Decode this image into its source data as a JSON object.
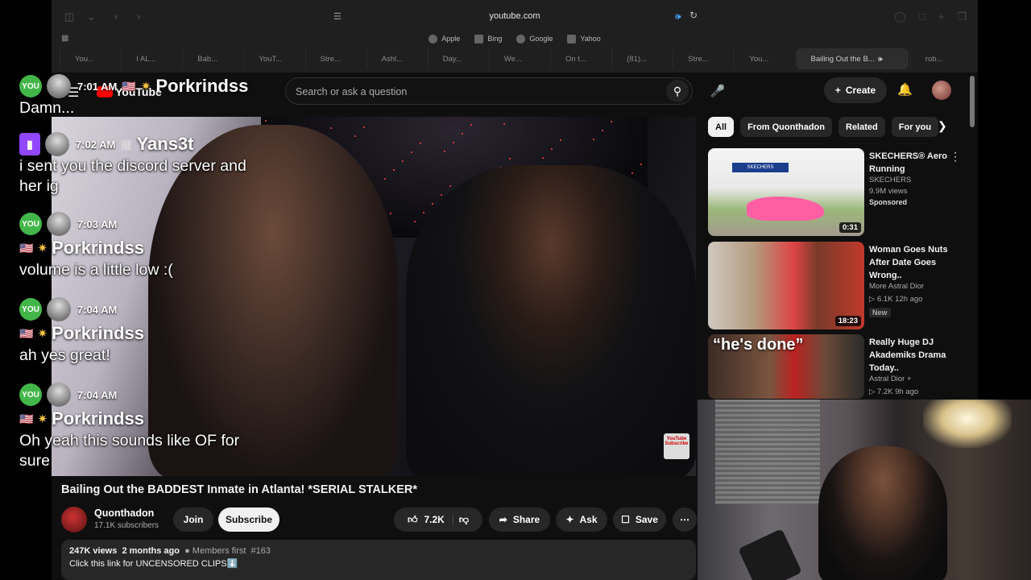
{
  "browser": {
    "url": "youtube.com",
    "favorites": [
      "Apple",
      "Bing",
      "Google",
      "Yahoo"
    ],
    "tabs": [
      "You...",
      "I AL...",
      "Bab...",
      "YouT...",
      "Stre...",
      "Ashl...",
      "Day...",
      "We...",
      "On t...",
      "(81)...",
      "Stre...",
      "You...",
      "Bailing Out the B...",
      "rob..."
    ],
    "active_tab_index": 12
  },
  "youtube": {
    "logo_text": "YouTube",
    "search_placeholder": "Search or ask a question",
    "create_label": "Create",
    "video": {
      "title": "Bailing Out the BADDEST Inmate in Atlanta! *SERIAL STALKER*",
      "channel": "Quonthadon",
      "subscribers": "17.1K subscribers",
      "join_label": "Join",
      "subscribe_label": "Subscribe",
      "likes": "7.2K",
      "share_label": "Share",
      "ask_label": "Ask",
      "save_label": "Save",
      "views": "247K views",
      "age": "2 months ago",
      "members": "Members first",
      "tag": "#163",
      "desc_line": "Click this link for UNCENSORED CLIPS⬇️"
    },
    "chips": [
      "All",
      "From Quonthadon",
      "Related",
      "For you"
    ],
    "recommendations": [
      {
        "title": "SKECHERS® Aero Running",
        "channel": "SKECHERS",
        "stats": "9.9M views",
        "badge": "Sponsored",
        "duration": "0:31"
      },
      {
        "title": "Woman Goes Nuts After Date Goes Wrong..",
        "channel": "More Astral Dior",
        "stats": "▷ 6.1K  12h ago",
        "badge": "New",
        "duration": "18:23"
      },
      {
        "title": "Really Huge DJ Akademiks Drama Today..",
        "channel": "Astral Dior +",
        "stats": "▷ 7.2K  9h ago",
        "overlay": "“he's done”"
      }
    ]
  },
  "chat": [
    {
      "platform": "YOU",
      "time": "7:01 AM",
      "name": "Porkrindss",
      "text": "Damn..."
    },
    {
      "platform": "twitch",
      "time": "7:02 AM",
      "name": "Yans3t",
      "text": "i sent you the discord server and her ig"
    },
    {
      "platform": "YOU",
      "time": "7:03 AM",
      "name": "Porkrindss",
      "text": "volume is a little low :("
    },
    {
      "platform": "YOU",
      "time": "7:04 AM",
      "name": "Porkrindss",
      "text": "ah yes great!"
    },
    {
      "platform": "YOU",
      "time": "7:04 AM",
      "name": "Porkrindss",
      "text": "Oh yeah this sounds like OF for sure"
    }
  ],
  "colors": {
    "yt_bg": "#0f0f0f",
    "youtube_red": "#ff0000",
    "chat_you_green": "#43b649",
    "twitch_purple": "#9146ff",
    "sound_blue": "#4aa3ff"
  }
}
